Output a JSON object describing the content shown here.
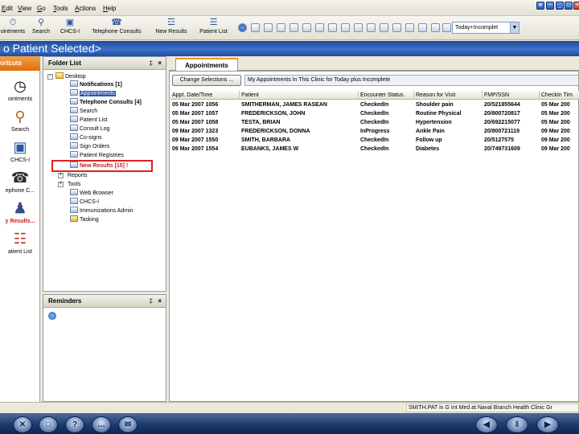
{
  "menu": [
    "Edit",
    "View",
    "Go",
    "Tools",
    "Actions",
    "Help"
  ],
  "toolbar": {
    "buttons": [
      "ointments",
      "Search",
      "CHCS-I",
      "Telephone Consults",
      "New Results",
      "Patient List"
    ],
    "filter_value": "Today+Incomplet"
  },
  "title_controls": {
    "icons": [
      "dock-icon",
      "tile-icon",
      "minimize-icon",
      "restore-icon",
      "close-icon"
    ]
  },
  "patient_bar": {
    "text": "o Patient Selected>"
  },
  "shortcuts": {
    "header": "ortcuts",
    "items": [
      "ointments",
      "Search",
      "CHCS-I",
      "ephone C...",
      "y Results...",
      "atient List"
    ]
  },
  "folder_list": {
    "title": "Folder List",
    "pin": "‡",
    "close": "×",
    "items": [
      {
        "label": "Desktop"
      },
      {
        "label": "Notifications [1]"
      },
      {
        "label": "Appointments"
      },
      {
        "label": "Telephone Consults [4]"
      },
      {
        "label": "Search"
      },
      {
        "label": "Patient List"
      },
      {
        "label": "Consult Log"
      },
      {
        "label": "Co-signs"
      },
      {
        "label": "Sign Orders"
      },
      {
        "label": "Patient Registries"
      },
      {
        "label": "New Results [15] !"
      },
      {
        "label": "Reports"
      },
      {
        "label": "Tools"
      },
      {
        "label": "Web Browser"
      },
      {
        "label": "CHCS-I"
      },
      {
        "label": "Immunizations Admin"
      },
      {
        "label": "Tasking"
      }
    ]
  },
  "reminders": {
    "title": "Reminders",
    "pin": "‡",
    "close": "×"
  },
  "content": {
    "tab": "Appointments",
    "change_button": "Change Selections ...",
    "description": "My Appointments In This Clinic for Today plus Incomplete",
    "columns": [
      "Appt. Date/Time",
      "Patient",
      "Encounter Status",
      "Reason for Visit",
      "FMP/SSN",
      "CheckIn Tim"
    ],
    "rows": [
      [
        "05 Mar 2007 1056",
        "SMITHERMAN, JAMES RASEAN",
        "CheckedIn",
        "Shoulder pain",
        "20/521855644",
        "05 Mar 200"
      ],
      [
        "05 Mar 2007 1057",
        "FREDERICKSON, JOHN",
        "CheckedIn",
        "Routine Physical",
        "20/800720817",
        "05 Mar 200"
      ],
      [
        "05 Mar 2007 1058",
        "TESTA, BRIAN",
        "CheckedIn",
        "Hypertension",
        "20/692215077",
        "05 Mar 200"
      ],
      [
        "09 Mar 2007 1323",
        "FREDERICKSON, DONNA",
        "InProgress",
        "Ankle Pain",
        "20/800721119",
        "09 Mar 200"
      ],
      [
        "09 Mar 2007 1550",
        "SMITH, BARBARA",
        "CheckedIn",
        "Follow up",
        "20/5127575",
        "09 Mar 200"
      ],
      [
        "09 Mar 2007 1554",
        "EUBANKS, JAMES W",
        "CheckedIn",
        "Diabetes",
        "20/749731609",
        "09 Mar 200"
      ]
    ]
  },
  "status_bar": {
    "text": "SMITH,PAT in G Int Med at Naval Branch Health Clinic Gr"
  },
  "nav_buttons": {
    "left": [
      "✕",
      "□",
      "?",
      "…",
      "✉"
    ],
    "right": [
      "◀",
      "‖",
      "▶"
    ]
  }
}
